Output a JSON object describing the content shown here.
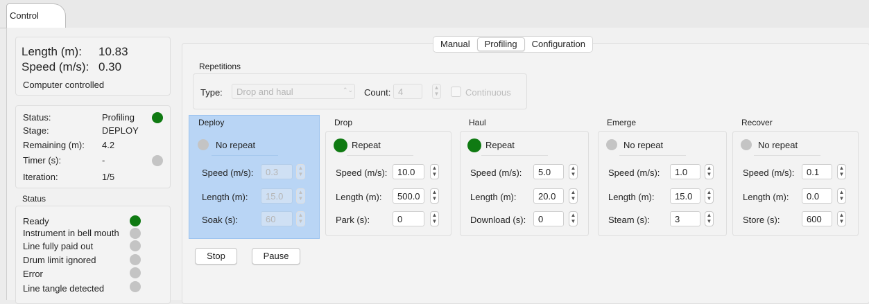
{
  "window": {
    "tab": "Control"
  },
  "readout": {
    "length_label": "Length (m):",
    "length_value": "10.83",
    "speed_label": "Speed (m/s):",
    "speed_value": "0.30",
    "mode": "Computer controlled"
  },
  "state": {
    "status_label": "Status:",
    "status_value": "Profiling",
    "stage_label": "Stage:",
    "stage_value": "DEPLOY",
    "remaining_label": "Remaining (m):",
    "remaining_value": "4.2",
    "timer_label": "Timer (s):",
    "timer_value": "-",
    "iteration_label": "Iteration:",
    "iteration_value": "1/5"
  },
  "indicators": {
    "title": "Status",
    "items": [
      {
        "label": "Ready",
        "on": true
      },
      {
        "label": "Instrument in bell mouth",
        "on": false
      },
      {
        "label": "Line fully paid out",
        "on": false
      },
      {
        "label": "Drum limit ignored",
        "on": false
      },
      {
        "label": "Error",
        "on": false
      },
      {
        "label": "Line tangle detected",
        "on": false
      }
    ]
  },
  "tabs": [
    "Manual",
    "Profiling",
    "Configuration"
  ],
  "repetitions": {
    "title": "Repetitions",
    "type_label": "Type:",
    "type_value": "Drop and haul",
    "count_label": "Count:",
    "count_value": "4",
    "continuous_label": "Continuous"
  },
  "stages": {
    "deploy": {
      "title": "Deploy",
      "repeat": "No repeat",
      "f1_label": "Speed (m/s):",
      "f1_value": "0.3",
      "f2_label": "Length (m):",
      "f2_value": "15.0",
      "f3_label": "Soak (s):",
      "f3_value": "60"
    },
    "drop": {
      "title": "Drop",
      "repeat": "Repeat",
      "f1_label": "Speed (m/s):",
      "f1_value": "10.0",
      "f2_label": "Length (m):",
      "f2_value": "500.0",
      "f3_label": "Park (s):",
      "f3_value": "0"
    },
    "haul": {
      "title": "Haul",
      "repeat": "Repeat",
      "f1_label": "Speed (m/s):",
      "f1_value": "5.0",
      "f2_label": "Length (m):",
      "f2_value": "20.0",
      "f3_label": "Download (s):",
      "f3_value": "0"
    },
    "emerge": {
      "title": "Emerge",
      "repeat": "No repeat",
      "f1_label": "Speed (m/s):",
      "f1_value": "1.0",
      "f2_label": "Length (m):",
      "f2_value": "15.0",
      "f3_label": "Steam (s):",
      "f3_value": "3"
    },
    "recover": {
      "title": "Recover",
      "repeat": "No repeat",
      "f1_label": "Speed (m/s):",
      "f1_value": "0.1",
      "f2_label": "Length (m):",
      "f2_value": "0.0",
      "f3_label": "Store (s):",
      "f3_value": "600"
    }
  },
  "buttons": {
    "stop": "Stop",
    "pause": "Pause"
  },
  "colors": {
    "active": "#0f7a12",
    "inactive": "#c4c4c4",
    "highlight": "#b9d5f5"
  }
}
